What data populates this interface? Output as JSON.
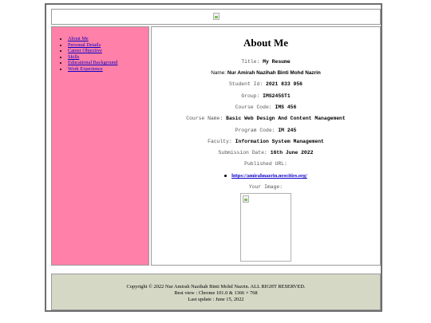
{
  "sidebar": {
    "items": [
      {
        "label": "About Me"
      },
      {
        "label": "Personal Details"
      },
      {
        "label": "Career Objective"
      },
      {
        "label": "Skills"
      },
      {
        "label": "Educational Background"
      },
      {
        "label": "Work Experience"
      }
    ]
  },
  "main": {
    "title": "About Me",
    "rows": [
      {
        "label": "Title:",
        "value": "My Resume"
      },
      {
        "label": "Name:",
        "value": "Nur Amirah Nazihah Binti Mohd Nazrin"
      },
      {
        "label": "Student Id:",
        "value": "2021 833 956"
      },
      {
        "label": "Group:",
        "value": "IMS245ST1"
      },
      {
        "label": "Course Code:",
        "value": "IMS 456"
      },
      {
        "label": "Course Name:",
        "value": "Basic Web Design And Content Management"
      },
      {
        "label": "Program Code:",
        "value": "IM 245"
      },
      {
        "label": "Faculty:",
        "value": "Information System Management"
      },
      {
        "label": "Submission Date:",
        "value": "16th June 2022"
      }
    ],
    "published_label": "Published URL:",
    "published_url": "https://amirahnazrin.neocities.org/",
    "image_label": "Your Image:"
  },
  "footer": {
    "copyright": "Copyright © 2022 Nur Amirah Nazihah Binti Mohd Nazrin. ALL RIGHT RESERVED.",
    "best_view": "Best view : Chrome 101.0 & 1366 × 768",
    "last_update": "Last update : June 15, 2022"
  }
}
